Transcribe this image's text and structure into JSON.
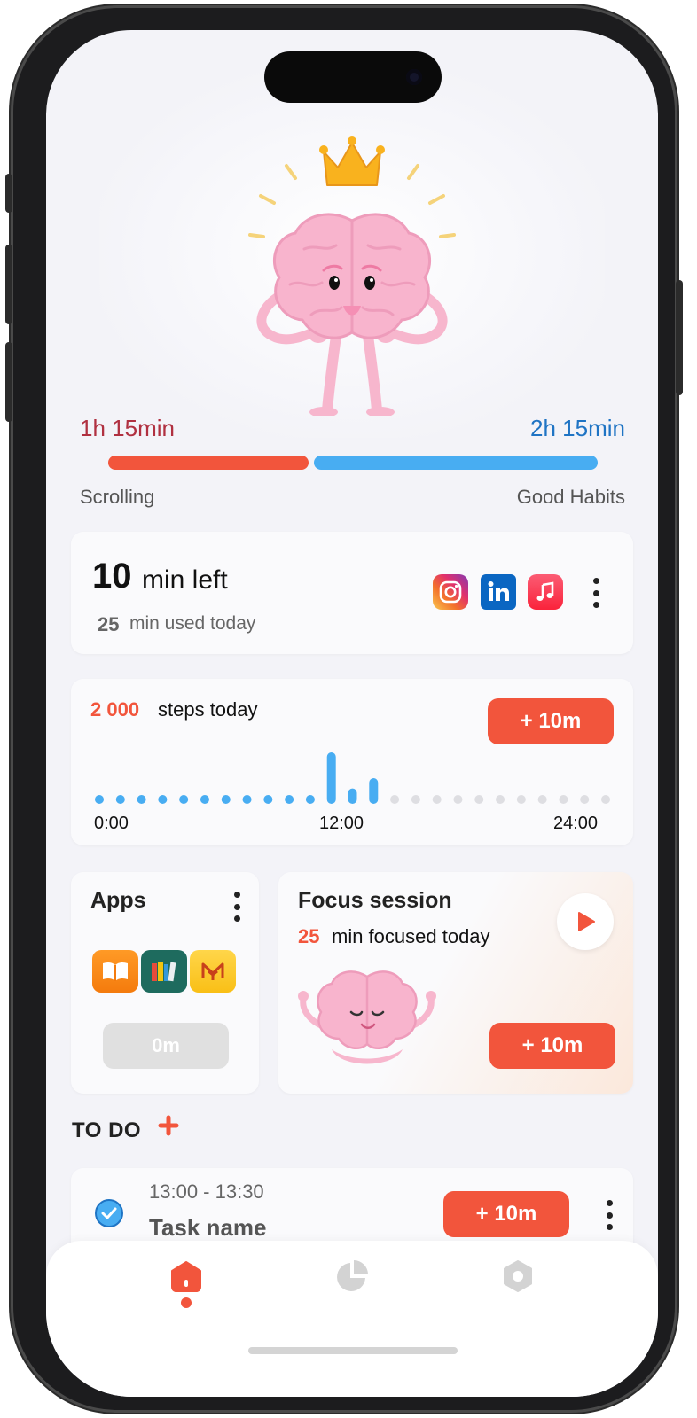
{
  "hero": {
    "scrolling_time": "1h 15min",
    "good_habits_time": "2h 15min",
    "scrolling_label": "Scrolling",
    "good_habits_label": "Good Habits",
    "scrolling_ratio": 0.41,
    "colors": {
      "scrolling": "#f2553c",
      "good_habits": "#48adf2"
    }
  },
  "limit_card": {
    "minutes_left": "10",
    "left_label": "min left",
    "used_minutes": "25",
    "used_label": "min used today",
    "apps": [
      "instagram-icon",
      "linkedin-icon",
      "music-icon"
    ]
  },
  "steps_card": {
    "steps": "2 000",
    "steps_label": "steps today",
    "add_button": "+ 10m",
    "tick_labels": [
      "0:00",
      "12:00",
      "24:00"
    ],
    "hourly_activity": [
      0,
      0,
      0,
      0,
      0,
      0,
      0,
      0,
      0,
      0,
      0,
      1.0,
      0.3,
      0.5,
      0,
      0,
      0,
      0,
      0,
      0,
      0,
      0,
      0,
      0,
      0
    ],
    "elapsed_slots": 14
  },
  "apps_card": {
    "title": "Apps",
    "apps": [
      "books-icon",
      "library-icon",
      "mymind-icon"
    ],
    "time": "0m"
  },
  "focus_card": {
    "title": "Focus session",
    "minutes": "25",
    "minutes_label": "min focused today",
    "add_button": "+ 10m"
  },
  "todo": {
    "title": "TO DO",
    "tasks": [
      {
        "time": "13:00 - 13:30",
        "name": "Task name",
        "button": "+ 10m",
        "done": true
      }
    ]
  },
  "tabs": [
    "home-tab",
    "stats-tab",
    "settings-tab"
  ],
  "colors": {
    "accent": "#f2553c",
    "blue": "#48adf2",
    "background": "#f3f3f8"
  }
}
